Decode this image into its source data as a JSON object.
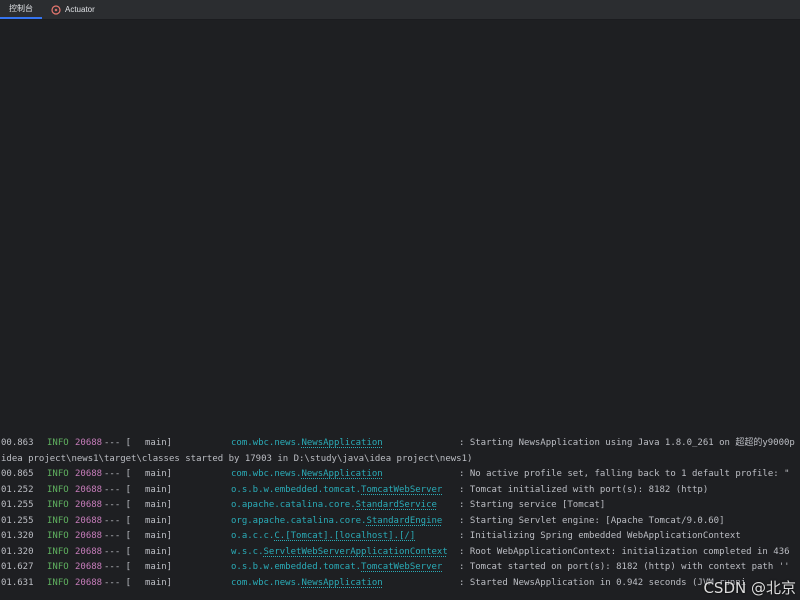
{
  "tabs": [
    {
      "label": "控制台",
      "active": true
    },
    {
      "label": "Actuator",
      "active": false,
      "icon": "actuator-icon"
    }
  ],
  "log": {
    "lines": [
      {
        "time": "00.863",
        "level": "INFO",
        "pid": "20688",
        "sep": "--- [",
        "thread": "main]",
        "logger_prefix": "com.wbc.news.",
        "logger_link": "NewsApplication",
        "message": ": Starting NewsApplication using Java 1.8.0_261 on 超超的y9000p"
      },
      {
        "continuation": "idea project\\news1\\target\\classes started by 17903 in D:\\study\\java\\idea project\\news1)"
      },
      {
        "time": "00.865",
        "level": "INFO",
        "pid": "20688",
        "sep": "--- [",
        "thread": "main]",
        "logger_prefix": "com.wbc.news.",
        "logger_link": "NewsApplication",
        "message": ": No active profile set, falling back to 1 default profile: \""
      },
      {
        "time": "01.252",
        "level": "INFO",
        "pid": "20688",
        "sep": "--- [",
        "thread": "main]",
        "logger_prefix": "o.s.b.w.embedded.tomcat.",
        "logger_link": "TomcatWebServer",
        "message": ": Tomcat initialized with port(s): 8182 (http)"
      },
      {
        "time": "01.255",
        "level": "INFO",
        "pid": "20688",
        "sep": "--- [",
        "thread": "main]",
        "logger_prefix": "o.apache.catalina.core.",
        "logger_link": "StandardService",
        "message": ": Starting service [Tomcat]"
      },
      {
        "time": "01.255",
        "level": "INFO",
        "pid": "20688",
        "sep": "--- [",
        "thread": "main]",
        "logger_prefix": "org.apache.catalina.core.",
        "logger_link": "StandardEngine",
        "message": ": Starting Servlet engine: [Apache Tomcat/9.0.60]"
      },
      {
        "time": "01.320",
        "level": "INFO",
        "pid": "20688",
        "sep": "--- [",
        "thread": "main]",
        "logger_prefix": "o.a.c.c.",
        "logger_link": "C.[Tomcat].[localhost].[/]",
        "message": ": Initializing Spring embedded WebApplicationContext"
      },
      {
        "time": "01.320",
        "level": "INFO",
        "pid": "20688",
        "sep": "--- [",
        "thread": "main]",
        "logger_prefix": "w.s.c.",
        "logger_link": "ServletWebServerApplicationContext",
        "message": ": Root WebApplicationContext: initialization completed in 436"
      },
      {
        "time": "01.627",
        "level": "INFO",
        "pid": "20688",
        "sep": "--- [",
        "thread": "main]",
        "logger_prefix": "o.s.b.w.embedded.tomcat.",
        "logger_link": "TomcatWebServer",
        "message": ": Tomcat started on port(s): 8182 (http) with context path ''"
      },
      {
        "time": "01.631",
        "level": "INFO",
        "pid": "20688",
        "sep": "--- [",
        "thread": "main]",
        "logger_prefix": "com.wbc.news.",
        "logger_link": "NewsApplication",
        "message": ": Started NewsApplication in 0.942 seconds (JVM runni"
      }
    ]
  },
  "watermark": "CSDN @北京"
}
